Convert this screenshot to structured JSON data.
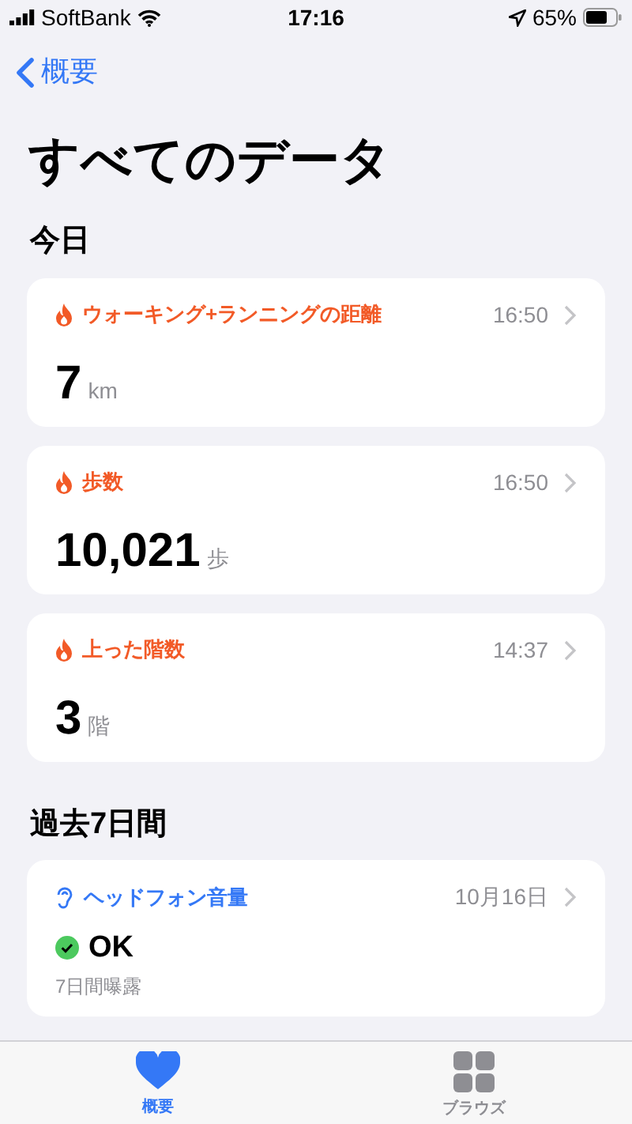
{
  "status_bar": {
    "carrier": "SoftBank",
    "time": "17:16",
    "battery": "65%"
  },
  "nav": {
    "back": "概要"
  },
  "title": "すべてのデータ",
  "sections": [
    {
      "title": "今日",
      "cards": [
        {
          "kind": "activity",
          "label": "ウォーキング+ランニングの距離",
          "time": "16:50",
          "value": "7",
          "unit": "km"
        },
        {
          "kind": "activity",
          "label": "歩数",
          "time": "16:50",
          "value": "10,021",
          "unit": "歩"
        },
        {
          "kind": "activity",
          "label": "上った階数",
          "time": "14:37",
          "value": "3",
          "unit": "階"
        }
      ]
    },
    {
      "title": "過去7日間",
      "cards": [
        {
          "kind": "hearing",
          "label": "ヘッドフォン音量",
          "time": "10月16日",
          "value": "OK",
          "note": "7日間曝露"
        }
      ]
    }
  ],
  "tabs": [
    {
      "label": "概要",
      "selected": true,
      "kind": "heart"
    },
    {
      "label": "ブラウズ",
      "selected": false,
      "kind": "grid"
    }
  ]
}
